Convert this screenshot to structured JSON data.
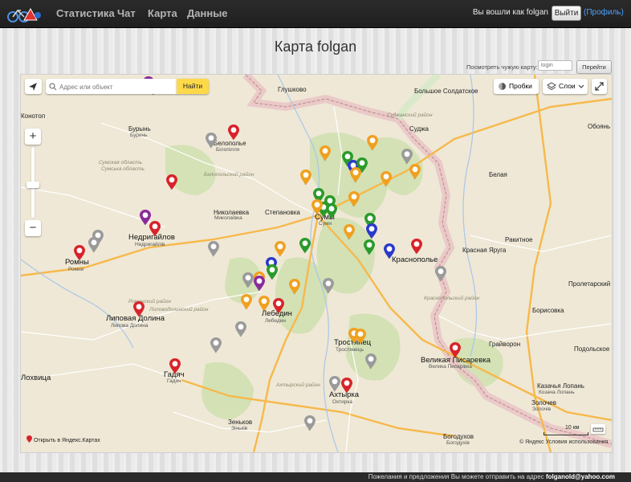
{
  "nav": {
    "items": [
      {
        "label": "Статистика"
      },
      {
        "label": "Чат"
      },
      {
        "label": "Карта"
      },
      {
        "label": "Данные"
      }
    ],
    "user_text": "Вы вошли как folgan",
    "logout_label": "Выйти",
    "profile_label": "(Профиль)"
  },
  "page": {
    "title": "Карта folgan",
    "other_map_label": "Посмотреть чужую карту:",
    "other_map_placeholder": "login",
    "other_map_button": "Перейти"
  },
  "map": {
    "search_placeholder": "Адрес или объект",
    "search_button": "Найти",
    "traffic_label": "Пробки",
    "layers_label": "Слои",
    "open_yandex": "Открыть в Яндекс.Картах",
    "scale_label": "10 км",
    "copyright": "© Яндекс",
    "terms": "Условия использования",
    "colors": {
      "red": "#d8232a",
      "orange": "#f0a020",
      "green": "#2a9a2a",
      "gray": "#9a9a9a",
      "purple": "#8a2a9a",
      "blue": "#2a3aca"
    },
    "cities": [
      {
        "name": "Глушково",
        "sub": ""
      },
      {
        "name": "Большое Солдатское",
        "sub": ""
      },
      {
        "name": "Суджа",
        "sub": ""
      },
      {
        "name": "Обоянь",
        "sub": ""
      },
      {
        "name": "Бурынь",
        "sub": "Буринь"
      },
      {
        "name": "Белополье",
        "sub": "Білопілля"
      },
      {
        "name": "Конотоп",
        "sub": ""
      },
      {
        "name": "Николаевка",
        "sub": "Миколаївка"
      },
      {
        "name": "Степановка",
        "sub": ""
      },
      {
        "name": "Сумы",
        "sub": "Суми"
      },
      {
        "name": "Белая",
        "sub": ""
      },
      {
        "name": "Ракитное",
        "sub": ""
      },
      {
        "name": "Недригайлов",
        "sub": "Недригайлів"
      },
      {
        "name": "Ромны",
        "sub": "Ромни"
      },
      {
        "name": "Краснополье",
        "sub": ""
      },
      {
        "name": "Красная Яруга",
        "sub": ""
      },
      {
        "name": "Пролетарский",
        "sub": ""
      },
      {
        "name": "Борисовка",
        "sub": ""
      },
      {
        "name": "Лебедин",
        "sub": "Лебедин"
      },
      {
        "name": "Липовая Долина",
        "sub": "Липова Долина"
      },
      {
        "name": "Грайворон",
        "sub": ""
      },
      {
        "name": "Тростянец",
        "sub": "Тростянець"
      },
      {
        "name": "Великая Писаревка",
        "sub": "Велика Писарівка"
      },
      {
        "name": "Гадяч",
        "sub": "Гадяч"
      },
      {
        "name": "Лохвица",
        "sub": ""
      },
      {
        "name": "Ахтырка",
        "sub": "Охтирка"
      },
      {
        "name": "Зеньков",
        "sub": "Зіньків"
      },
      {
        "name": "Богодухов",
        "sub": "Богодухів"
      },
      {
        "name": "Золочев",
        "sub": "Золочів"
      },
      {
        "name": "Казачья Лопань",
        "sub": "Козача Лопань"
      },
      {
        "name": "Подольское",
        "sub": ""
      }
    ]
  },
  "footer": {
    "text": "Пожелания и предложения Вы можете отправить на адрес",
    "email": "folganold@yahoo.com"
  }
}
